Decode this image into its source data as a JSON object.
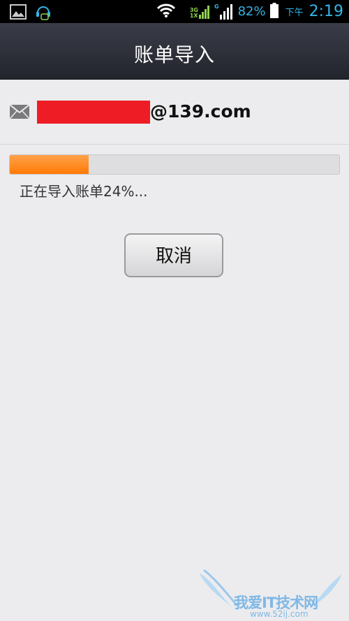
{
  "status_bar": {
    "icons_left": [
      "gallery-notification-icon",
      "headset-chat-notification-icon"
    ],
    "network_tags": [
      "3G",
      "1X",
      "G"
    ],
    "battery_percent": "82%",
    "ampm": "下午",
    "time": "2:19",
    "accent_color": "#33b5e5"
  },
  "header": {
    "title": "账单导入"
  },
  "account": {
    "icon": "mail-icon",
    "email_suffix": "@139.com",
    "redaction_color": "#ee1c25"
  },
  "progress": {
    "value": 0.24,
    "label": "正在导入账单24%...",
    "fill_color": "#ff8a1a"
  },
  "actions": {
    "cancel_label": "取消"
  },
  "watermark": {
    "text": "我爱IT技术网",
    "url": "www.52ij.com"
  }
}
